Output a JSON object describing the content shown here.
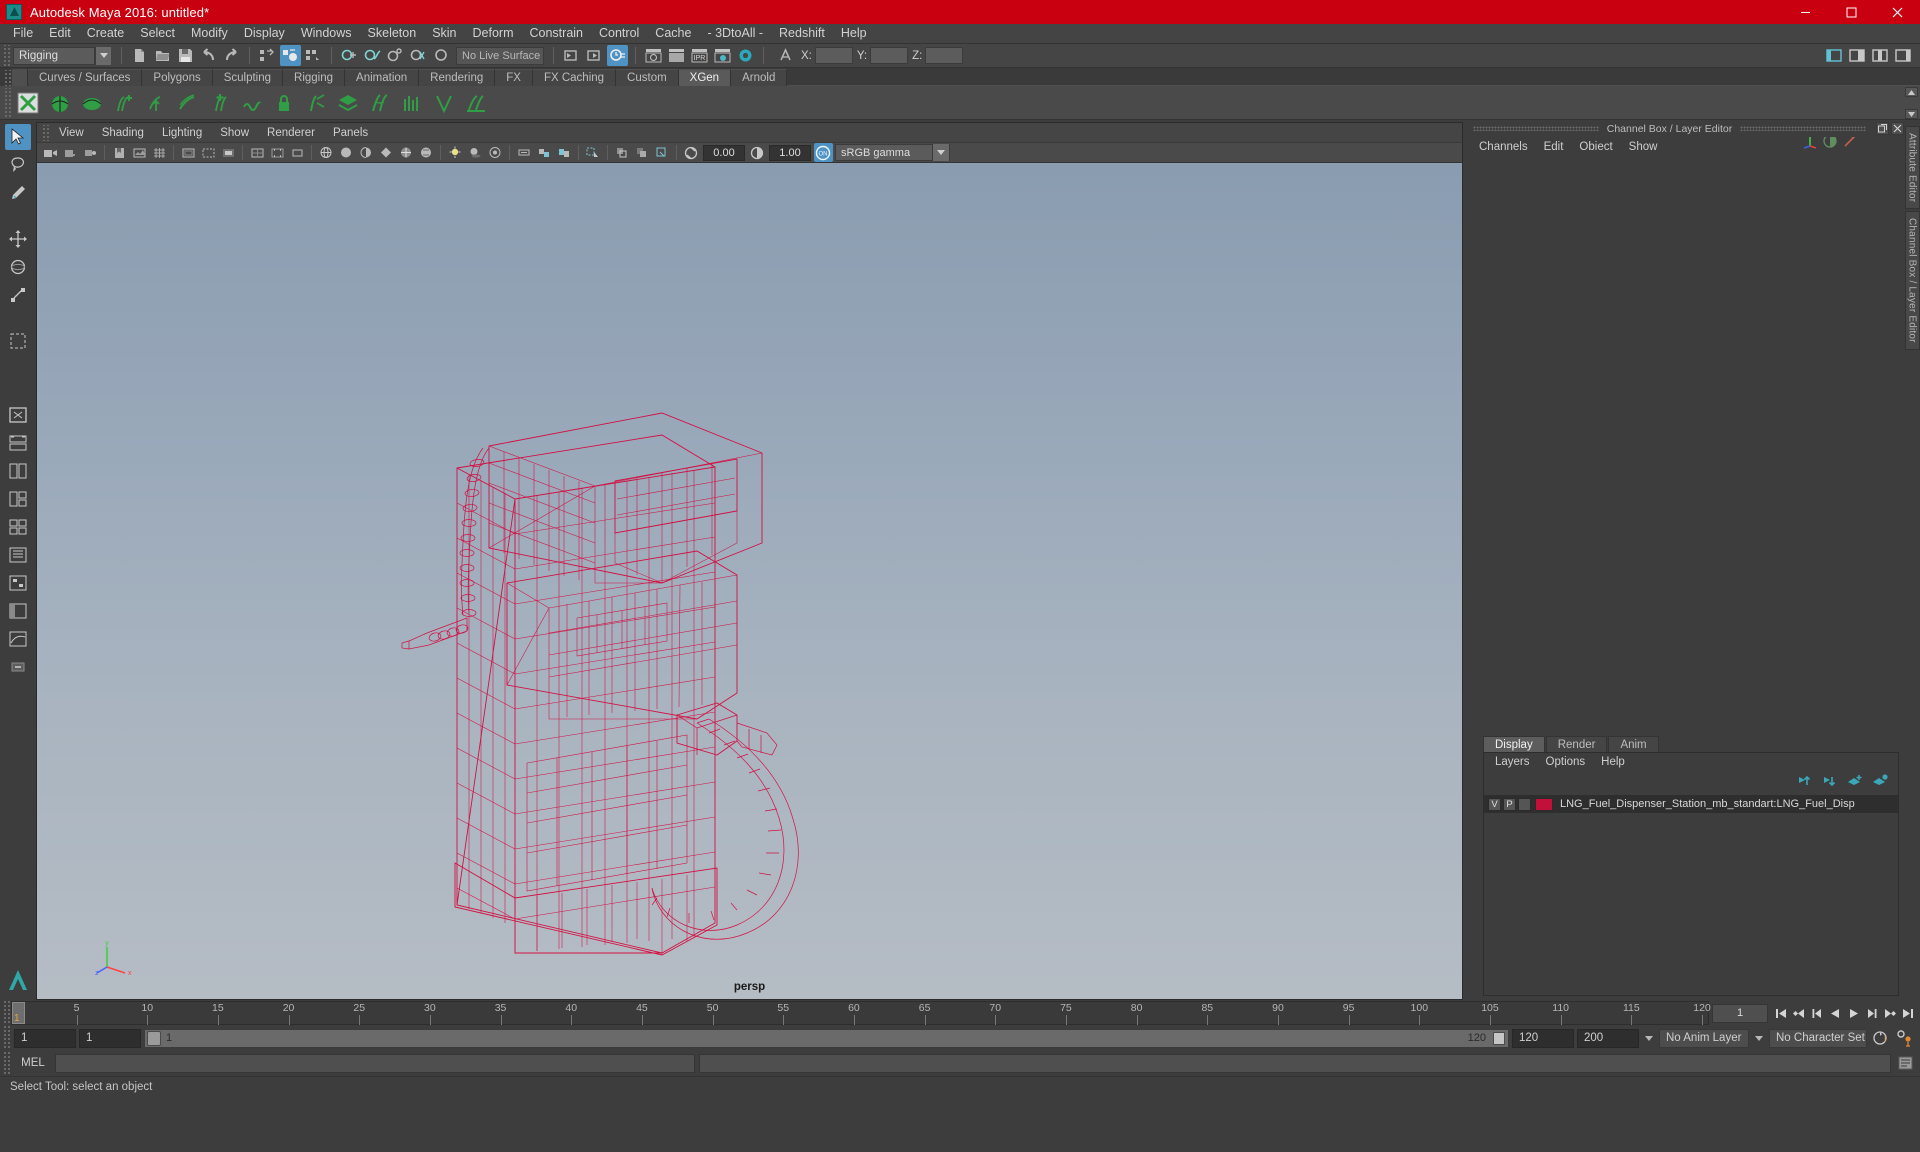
{
  "titlebar": {
    "title": "Autodesk Maya 2016: untitled*",
    "logo_icon": "maya-logo-icon",
    "minimize_icon": "minimize-icon",
    "maximize_icon": "maximize-icon",
    "close_icon": "close-icon"
  },
  "menubar": {
    "items": [
      "File",
      "Edit",
      "Create",
      "Select",
      "Modify",
      "Display",
      "Windows",
      "Skeleton",
      "Skin",
      "Deform",
      "Constrain",
      "Control",
      "Cache",
      "- 3DtoAll -",
      "Redshift",
      "Help"
    ]
  },
  "statusline": {
    "mode": "Rigging",
    "live_surface": "No Live Surface",
    "coord_x_label": "X:",
    "coord_y_label": "Y:",
    "coord_z_label": "Z:",
    "coord_x_value": "",
    "coord_y_value": "",
    "coord_z_value": "",
    "icons": [
      "new-scene-icon",
      "open-scene-icon",
      "save-scene-icon",
      "undo-icon",
      "redo-icon",
      "select-hierarchy-icon",
      "select-object-icon",
      "select-component-icon",
      "snap-grid-icon",
      "snap-curve-icon",
      "snap-point-icon",
      "snap-projected-icon",
      "snap-view-plane-icon",
      "input-connection-icon",
      "output-connection-icon",
      "construction-history-icon",
      "render-current-frame-icon",
      "render-sequence-icon",
      "ipr-render-icon",
      "render-settings-icon",
      "hypershade-icon",
      "show-editor-icon",
      "sidebar-attribute-icon",
      "sidebar-tool-icon",
      "sidebar-channel-icon"
    ]
  },
  "shelf": {
    "tabs": [
      "Curves / Surfaces",
      "Polygons",
      "Sculpting",
      "Rigging",
      "Animation",
      "Rendering",
      "FX",
      "FX Caching",
      "Custom",
      "XGen",
      "Arnold"
    ],
    "selected_tab": "XGen",
    "icons": [
      "xgen-editor-icon",
      "xgen-sphere-icon",
      "xgen-patch-icon",
      "xgen-add-guide-icon",
      "xgen-sculpt-guide-icon",
      "xgen-comb-icon",
      "xgen-add-icon",
      "xgen-noise-icon",
      "xgen-lock-icon",
      "xgen-cut-icon",
      "xgen-layer-icon",
      "xgen-clump-icon",
      "xgen-density-icon",
      "xgen-region-icon",
      "xgen-preview-icon"
    ]
  },
  "toolbox": {
    "items": [
      {
        "name": "select-tool",
        "selected": true
      },
      {
        "name": "lasso-select-tool",
        "selected": false
      },
      {
        "name": "paint-select-tool",
        "selected": false
      },
      {
        "name": "move-tool",
        "selected": false
      },
      {
        "name": "rotate-tool",
        "selected": false
      },
      {
        "name": "scale-tool",
        "selected": false
      },
      {
        "name": "last-tool",
        "selected": false
      }
    ],
    "layout_items": [
      "layout-single-icon",
      "layout-two-stacked-icon",
      "layout-two-side-icon",
      "layout-three-icon",
      "layout-four-icon",
      "layout-outliner-icon",
      "layout-hypergraph-icon",
      "layout-persp-outliner-icon",
      "layout-persp-graph-icon",
      "layout-more-icon"
    ],
    "maya_logo": "maya-logo-icon"
  },
  "viewport": {
    "menus": [
      "View",
      "Shading",
      "Lighting",
      "Show",
      "Renderer",
      "Panels"
    ],
    "camera_label": "persp",
    "exposure_value": "0.00",
    "gamma_value": "1.00",
    "color_management": "sRGB gamma",
    "toolbar_icons": [
      "select-camera-icon",
      "lock-camera-icon",
      "camera-attributes-icon",
      "bookmark-icon",
      "image-plane-icon",
      "grid-toggle-icon",
      "film-gate-icon",
      "resolution-gate-icon",
      "gate-mask-icon",
      "field-chart-icon",
      "safe-action-icon",
      "safe-title-icon",
      "wireframe-shading-icon",
      "smooth-shade-all-icon",
      "smooth-shade-selected-icon",
      "flat-shade-icon",
      "shaded-wireframe-icon",
      "textured-icon",
      "use-all-lights-icon",
      "shadows-icon",
      "screen-space-ao-icon",
      "motion-blur-icon",
      "multisample-icon",
      "depth-of-field-icon",
      "isolate-select-icon",
      "xray-icon",
      "xray-joints-icon",
      "exposure-icon",
      "contrast-icon",
      "color-management-toggle-icon"
    ],
    "model": {
      "name": "LNG Fuel Dispenser Station",
      "display": "wireframe",
      "wire_color": "#d4083c"
    }
  },
  "right_dock": {
    "panel_title": "Channel Box / Layer Editor",
    "float_icon": "undock-icon",
    "close_icon": "close-panel-icon",
    "channelbox_menus": [
      "Channels",
      "Edit",
      "Object",
      "Show"
    ],
    "channelbox_icons": [
      "transform-channels-icon",
      "output-channels-icon",
      "shapes-icon"
    ],
    "side_tabs": [
      "Attribute Editor",
      "Channel Box / Layer Editor"
    ],
    "layer_editor": {
      "tabs": [
        "Display",
        "Render",
        "Anim"
      ],
      "selected_tab": "Display",
      "menus": [
        "Layers",
        "Options",
        "Help"
      ],
      "buttons": [
        "move-layer-up-icon",
        "move-layer-down-icon",
        "new-layer-icon",
        "new-layer-from-selected-icon"
      ],
      "layers": [
        {
          "visibility": "V",
          "playback": "P",
          "shading": "",
          "color": "#c2103a",
          "name": "LNG_Fuel_Dispenser_Station_mb_standart:LNG_Fuel_Disp"
        }
      ]
    }
  },
  "time_slider": {
    "current_frame": "1",
    "ticks": [
      5,
      10,
      15,
      20,
      25,
      30,
      35,
      40,
      45,
      50,
      55,
      60,
      65,
      70,
      75,
      80,
      85,
      90,
      95,
      100,
      105,
      110,
      115,
      120
    ],
    "start": 1,
    "end": 120,
    "frame_field": "1",
    "playback_icons": [
      "go-to-start-icon",
      "step-back-key-icon",
      "step-back-frame-icon",
      "play-backwards-icon",
      "play-forwards-icon",
      "step-forward-frame-icon",
      "step-forward-key-icon",
      "go-to-end-icon"
    ]
  },
  "range_slider": {
    "anim_start": "1",
    "range_start": "1",
    "bar_start_label": "1",
    "bar_end_label": "120",
    "range_end": "120",
    "anim_end": "200",
    "anim_layer": "No Anim Layer",
    "character_set": "No Character Set",
    "auto_key_icon": "auto-keyframe-icon",
    "anim_prefs_icon": "animation-preferences-icon"
  },
  "command_line": {
    "language": "MEL",
    "input_value": "",
    "output_value": "",
    "script_editor_icon": "script-editor-icon"
  },
  "help_line": {
    "text": "Select Tool: select an object"
  }
}
